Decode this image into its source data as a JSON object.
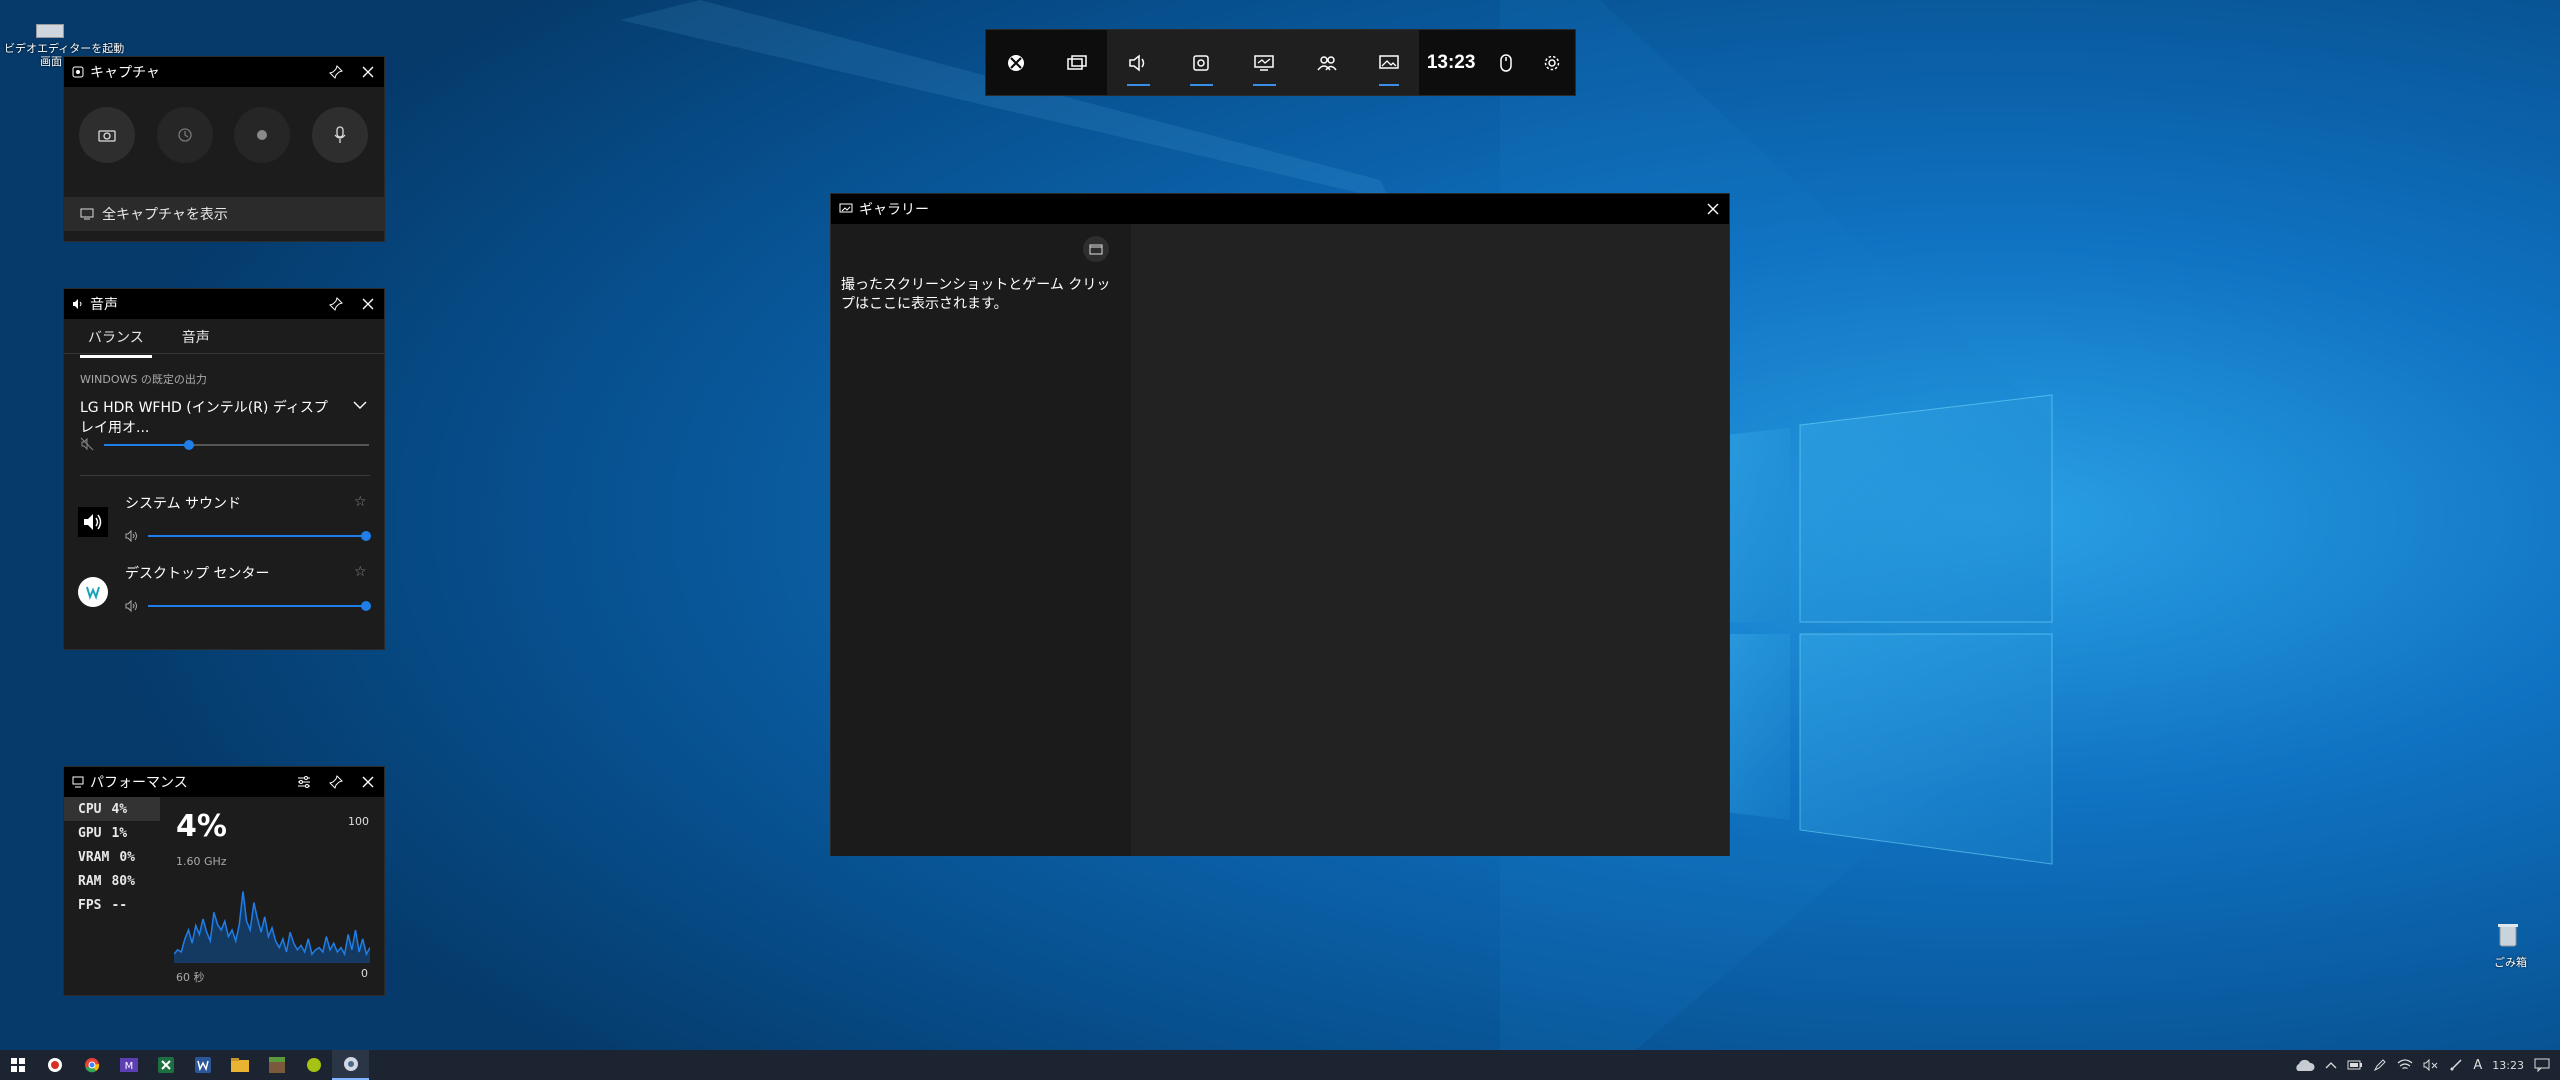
{
  "desktop": {
    "icon_video_label_line1": "ビデオエディターを起動",
    "icon_video_label_line2": "画面",
    "recycle_bin_label": "ごみ箱"
  },
  "gamebar": {
    "clock": "13:23",
    "buttons": [
      "xbox-icon",
      "widget-menu-icon",
      "audio-icon",
      "capture-icon",
      "performance-icon",
      "xbox-social-icon",
      "gallery-icon",
      "mouse-icon",
      "settings-icon"
    ]
  },
  "capture": {
    "title": "キャプチャ",
    "show_all": "全キャプチャを表示"
  },
  "audio": {
    "title": "音声",
    "tab_mix": "バランス",
    "tab_voice": "音声",
    "windows_default_output": "WINDOWS の既定の出力",
    "device": "LG HDR WFHD (インテル(R) ディスプレイ用オ...",
    "master_volume_fraction": 0.32,
    "apps": [
      {
        "name": "システム サウンド",
        "volume_fraction": 1.0
      },
      {
        "name": "デスクトップ センター",
        "volume_fraction": 1.0
      }
    ]
  },
  "performance": {
    "title": "パフォーマンス",
    "rows": [
      {
        "label": "CPU",
        "value": "4%"
      },
      {
        "label": "GPU",
        "value": "1%"
      },
      {
        "label": "VRAM",
        "value": "0%"
      },
      {
        "label": "RAM",
        "value": "80%"
      },
      {
        "label": "FPS",
        "value": "--"
      }
    ],
    "current_value": "4%",
    "clock_speed": "1.60 GHz",
    "max_label": "100",
    "min_label": "0",
    "time_label": "60 秒",
    "graph_values": [
      8,
      12,
      10,
      22,
      30,
      18,
      34,
      26,
      40,
      28,
      20,
      46,
      35,
      30,
      38,
      24,
      30,
      20,
      35,
      65,
      38,
      30,
      55,
      40,
      28,
      42,
      24,
      32,
      20,
      14,
      22,
      10,
      28,
      18,
      12,
      16,
      10,
      22,
      8,
      12,
      14,
      10,
      24,
      12,
      18,
      10,
      14,
      8,
      26,
      12,
      30,
      10,
      22,
      8,
      14
    ]
  },
  "gallery": {
    "title": "ギャラリー",
    "empty_message": "撮ったスクリーンショットとゲーム クリップはここに表示されます。"
  },
  "taskbar": {
    "time": "13:23",
    "ime_label": "A",
    "apps": [
      "start-icon",
      "screen-recorder-icon",
      "chrome-icon",
      "mixer-icon",
      "excel-icon",
      "word-icon",
      "file-explorer-icon",
      "minecraft-icon",
      "green-app-icon",
      "chat-app-icon"
    ]
  },
  "colors": {
    "accent": "#1f7ee8",
    "widget_bg": "#1c1c1c",
    "titlebar_bg": "#000000",
    "graph_line": "#1f7ee8"
  }
}
